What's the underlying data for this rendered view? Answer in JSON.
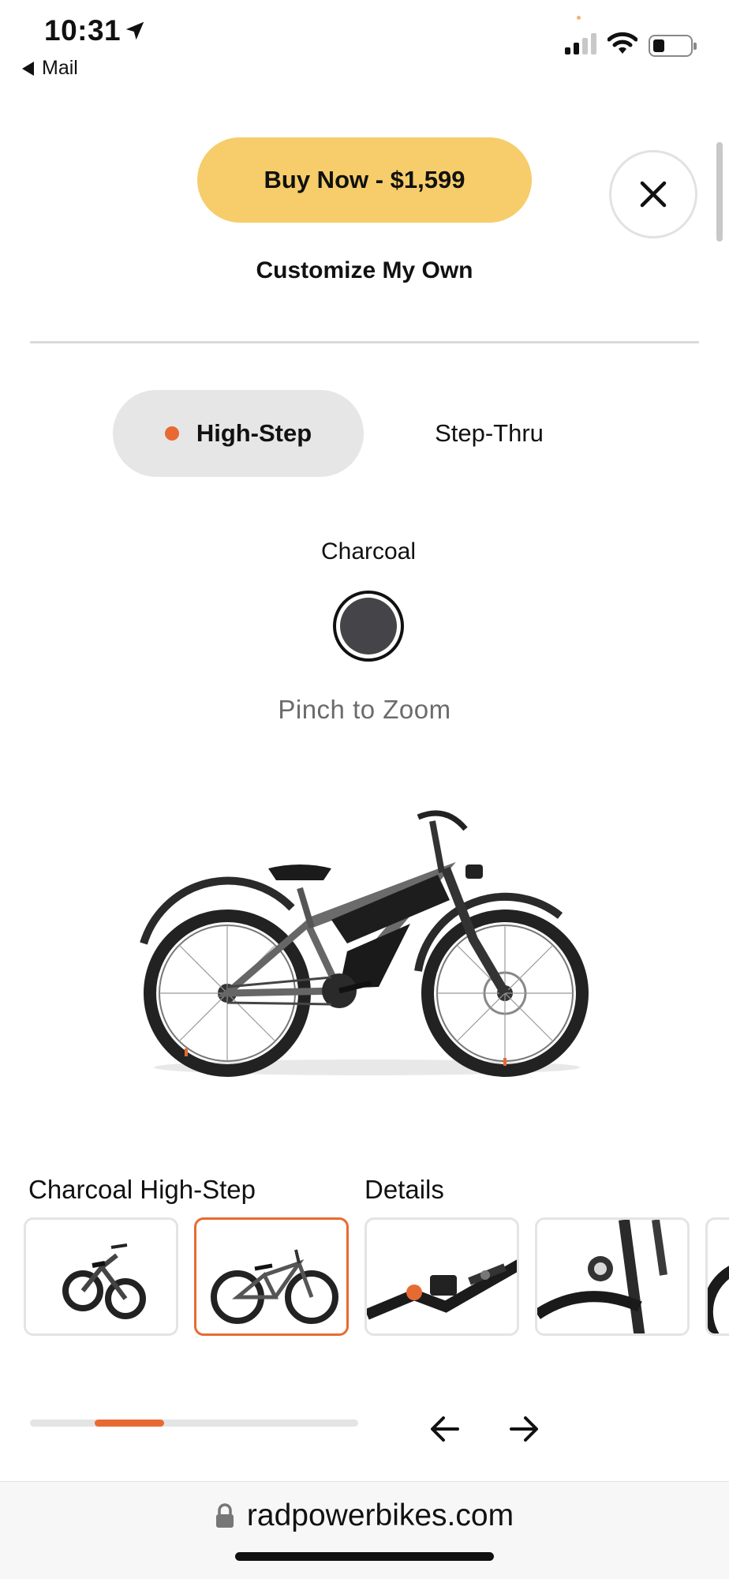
{
  "status_bar": {
    "time": "10:31",
    "back_app": "Mail",
    "icons": [
      "location-arrow-icon",
      "cellular-signal-icon",
      "wifi-icon",
      "battery-icon"
    ]
  },
  "actions": {
    "buy_label": "Buy Now - $1,599",
    "customize_label": "Customize My Own",
    "close_icon": "close-icon"
  },
  "frame_options": {
    "selected": "High-Step",
    "other": "Step-Thru"
  },
  "color": {
    "name": "Charcoal",
    "swatch_hex": "#454549"
  },
  "hint": "Pinch to Zoom",
  "gallery": {
    "variant_label": "Charcoal High-Step",
    "details_label": "Details",
    "selected_index": 1,
    "progress_fraction": 0.25,
    "thumbnails": [
      "bike-front-angle",
      "bike-side-charcoal",
      "handlebar-display-detail",
      "headlight-fork-detail",
      "wheel-detail-partial"
    ]
  },
  "nav": {
    "prev_icon": "arrow-left-icon",
    "next_icon": "arrow-right-icon"
  },
  "browser": {
    "url": "radpowerbikes.com",
    "lock_icon": "lock-icon"
  },
  "colors": {
    "buy_button": "#f6cd6a",
    "accent": "#e86a33",
    "toggle_bg": "#e6e6e6"
  }
}
